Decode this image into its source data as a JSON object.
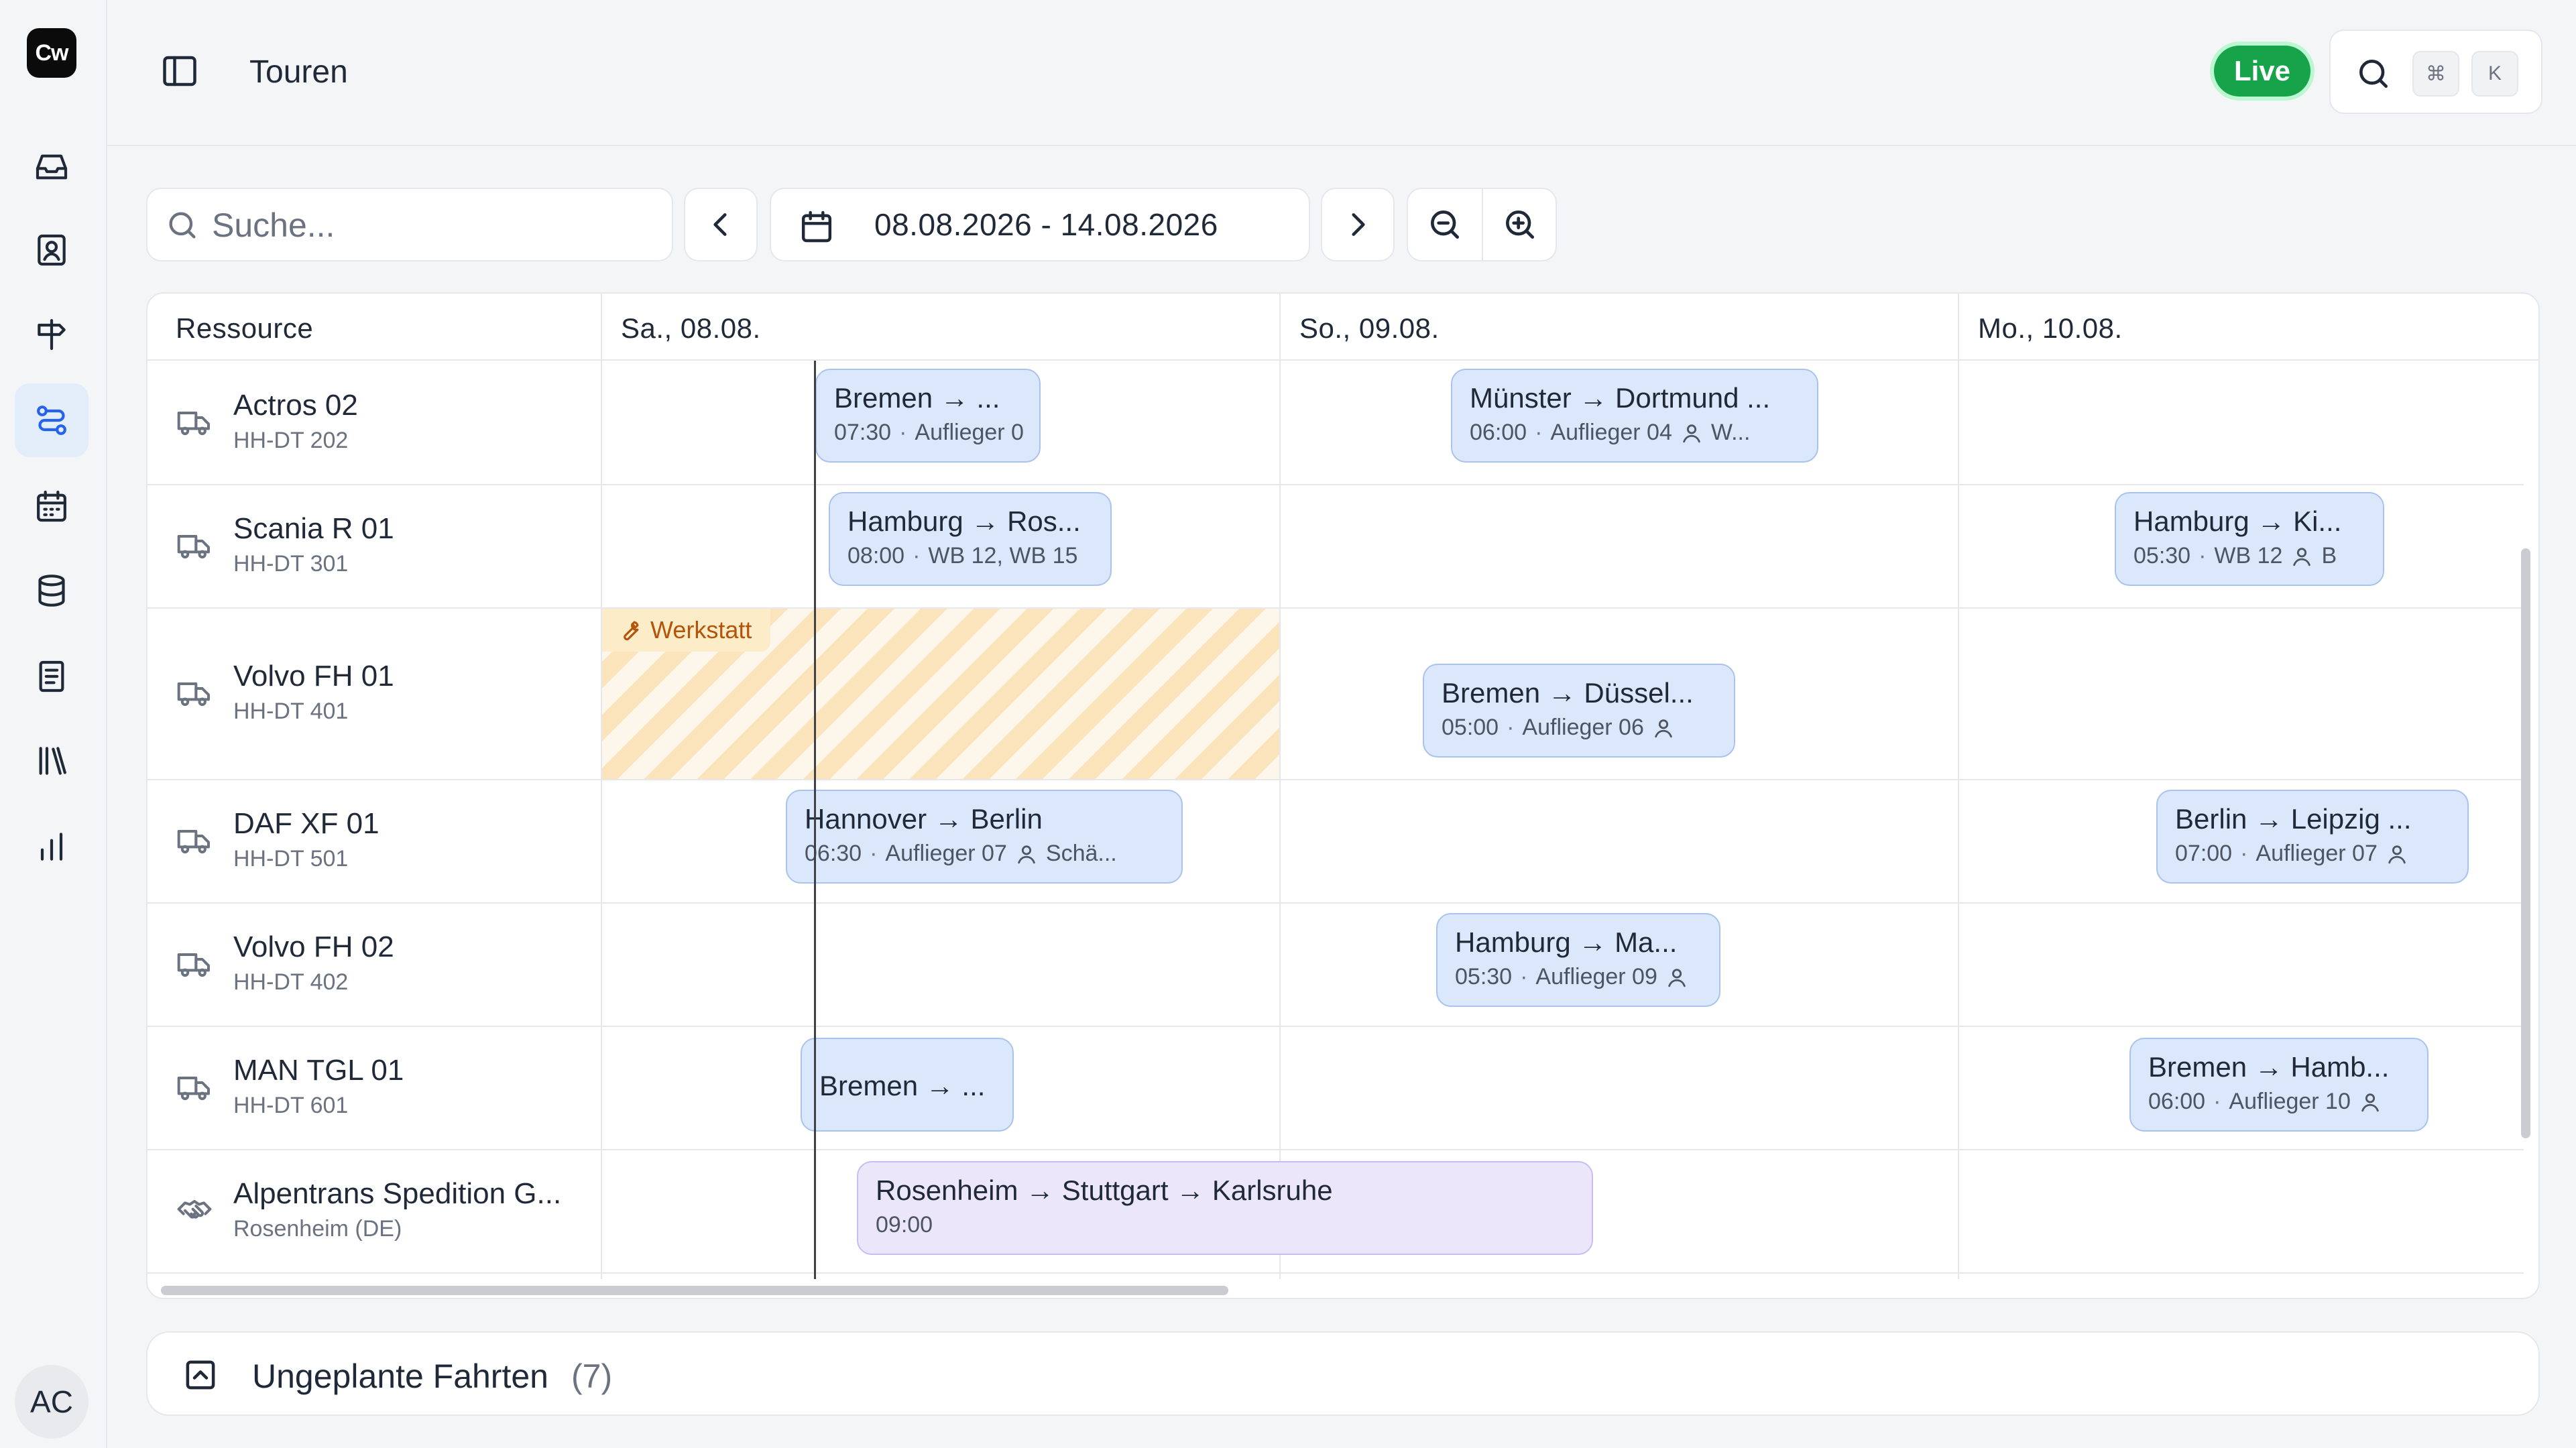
{
  "app": {
    "logo_text": "Cw",
    "avatar_initials": "AC"
  },
  "sidebar": {
    "items": [
      {
        "icon": "inbox-icon"
      },
      {
        "icon": "contacts-icon"
      },
      {
        "icon": "signpost-icon"
      },
      {
        "icon": "routes-icon",
        "active": true
      },
      {
        "icon": "calendar-icon"
      },
      {
        "icon": "database-icon"
      },
      {
        "icon": "document-icon"
      },
      {
        "icon": "library-icon"
      },
      {
        "icon": "chart-icon"
      }
    ]
  },
  "header": {
    "title": "Touren",
    "live_label": "Live",
    "shortcut_keys": [
      "⌘",
      "K"
    ]
  },
  "toolbar": {
    "search_placeholder": "Suche...",
    "date_range": "08.08.2026 - 14.08.2026"
  },
  "grid": {
    "resource_header": "Ressource",
    "days": [
      "Sa., 08.08.",
      "So., 09.08.",
      "Mo., 10.08."
    ],
    "resources": [
      {
        "name": "Actros 02",
        "plate": "HH-DT 202",
        "icon": "truck-icon"
      },
      {
        "name": "Scania R 01",
        "plate": "HH-DT 301",
        "icon": "truck-icon"
      },
      {
        "name": "Volvo FH 01",
        "plate": "HH-DT 401",
        "icon": "truck-icon"
      },
      {
        "name": "DAF XF 01",
        "plate": "HH-DT 501",
        "icon": "truck-icon"
      },
      {
        "name": "Volvo FH 02",
        "plate": "HH-DT 402",
        "icon": "truck-icon"
      },
      {
        "name": "MAN TGL 01",
        "plate": "HH-DT 601",
        "icon": "truck-icon"
      },
      {
        "name": "Alpentrans Spedition G...",
        "plate": "Rosenheim (DE)",
        "icon": "handshake-icon"
      }
    ],
    "workshop_label": "Werkstatt",
    "events": [
      {
        "title": "Bremen → ...",
        "time": "07:30",
        "detail": "Auflieger 0"
      },
      {
        "title": "Münster → Dortmund ...",
        "time": "06:00",
        "detail": "Auflieger 04",
        "driver": "W..."
      },
      {
        "title": "Hamburg → Ros...",
        "time": "08:00",
        "detail": "WB 12, WB 15"
      },
      {
        "title": "Hamburg → Ki...",
        "time": "05:30",
        "detail": "WB 12",
        "driver": "B"
      },
      {
        "title": "Bremen → Düssel...",
        "time": "05:00",
        "detail": "Auflieger 06",
        "driver": ""
      },
      {
        "title": "Hannover → Berlin",
        "time": "06:30",
        "detail": "Auflieger 07",
        "driver": "Schä..."
      },
      {
        "title": "Berlin → Leipzig ...",
        "time": "07:00",
        "detail": "Auflieger 07",
        "driver": ""
      },
      {
        "title": "Hamburg → Ma...",
        "time": "05:30",
        "detail": "Auflieger 09",
        "driver": ""
      },
      {
        "title": "Bremen → ..."
      },
      {
        "title": "Bremen → Hamb...",
        "time": "06:00",
        "detail": "Auflieger 10",
        "driver": ""
      },
      {
        "title": "Rosenheim → Stuttgart → Karlsruhe",
        "time": "09:00"
      }
    ]
  },
  "unplanned": {
    "label": "Ungeplante Fahrten",
    "count": "(7)"
  }
}
